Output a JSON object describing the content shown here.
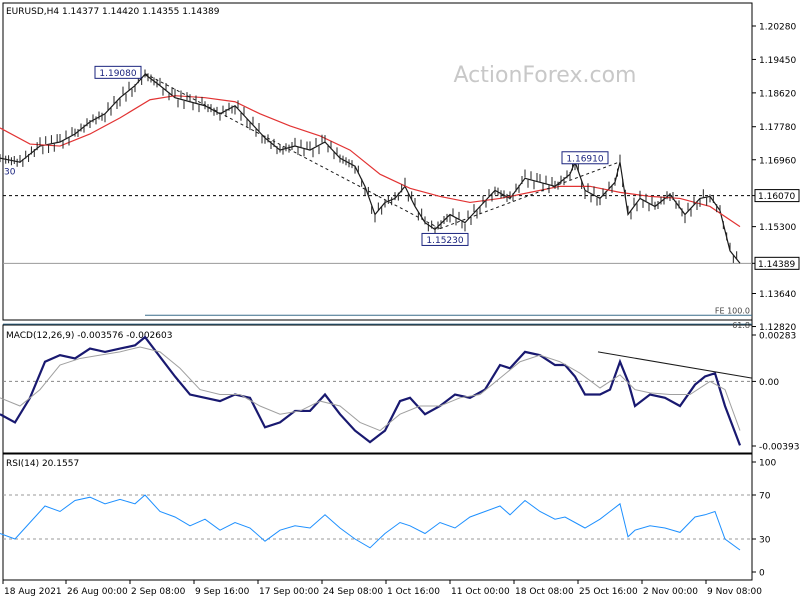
{
  "chart_data": [
    {
      "type": "line",
      "panel": "price",
      "title": "EURUSD,H4  1.14377 1.14420 1.14355 1.14389",
      "watermark": "ActionForex.com",
      "y_ticks": [
        "1.20280",
        "1.19450",
        "1.18620",
        "1.17780",
        "1.16960",
        "1.16070",
        "1.15300",
        "1.14389",
        "1.13640",
        "1.12820"
      ],
      "ylim": [
        1.1282,
        1.2068
      ],
      "x_ticks": [
        "18 Aug 2021",
        "26 Aug 00:00",
        "2 Sep 08:00",
        "9 Sep 16:00",
        "17 Sep 00:00",
        "24 Sep 08:00",
        "1 Oct 16:00",
        "11 Oct 00:00",
        "18 Oct 08:00",
        "25 Oct 16:00",
        "2 Nov 00:00",
        "9 Nov 08:00"
      ],
      "series": [
        {
          "name": "EURUSD",
          "color": "#1a1a1a",
          "points": [
            [
              0,
              1.17
            ],
            [
              20,
              1.169
            ],
            [
              40,
              1.173
            ],
            [
              60,
              1.174
            ],
            [
              75,
              1.176
            ],
            [
              90,
              1.179
            ],
            [
              105,
              1.181
            ],
            [
              120,
              1.185
            ],
            [
              135,
              1.188
            ],
            [
              145,
              1.1908
            ],
            [
              160,
              1.188
            ],
            [
              175,
              1.185
            ],
            [
              190,
              1.184
            ],
            [
              205,
              1.183
            ],
            [
              220,
              1.181
            ],
            [
              235,
              1.183
            ],
            [
              250,
              1.179
            ],
            [
              265,
              1.175
            ],
            [
              280,
              1.172
            ],
            [
              295,
              1.173
            ],
            [
              310,
              1.172
            ],
            [
              325,
              1.174
            ],
            [
              340,
              1.17
            ],
            [
              355,
              1.168
            ],
            [
              365,
              1.163
            ],
            [
              375,
              1.156
            ],
            [
              385,
              1.159
            ],
            [
              395,
              1.16
            ],
            [
              405,
              1.163
            ],
            [
              415,
              1.158
            ],
            [
              425,
              1.154
            ],
            [
              435,
              1.1523
            ],
            [
              450,
              1.156
            ],
            [
              465,
              1.154
            ],
            [
              480,
              1.158
            ],
            [
              495,
              1.162
            ],
            [
              510,
              1.16
            ],
            [
              525,
              1.165
            ],
            [
              540,
              1.164
            ],
            [
              555,
              1.163
            ],
            [
              570,
              1.166
            ],
            [
              575,
              1.1691
            ],
            [
              585,
              1.162
            ],
            [
              600,
              1.16
            ],
            [
              615,
              1.164
            ],
            [
              620,
              1.169
            ],
            [
              628,
              1.156
            ],
            [
              640,
              1.16
            ],
            [
              655,
              1.158
            ],
            [
              670,
              1.161
            ],
            [
              685,
              1.156
            ],
            [
              700,
              1.16
            ],
            [
              710,
              1.1605
            ],
            [
              720,
              1.157
            ],
            [
              730,
              1.147
            ],
            [
              740,
              1.1439
            ]
          ]
        },
        {
          "name": "MA",
          "color": "#e23333",
          "points": [
            [
              0,
              1.1775
            ],
            [
              30,
              1.1735
            ],
            [
              60,
              1.173
            ],
            [
              90,
              1.176
            ],
            [
              120,
              1.18
            ],
            [
              150,
              1.1845
            ],
            [
              175,
              1.1855
            ],
            [
              205,
              1.185
            ],
            [
              235,
              1.184
            ],
            [
              260,
              1.181
            ],
            [
              290,
              1.178
            ],
            [
              320,
              1.1755
            ],
            [
              350,
              1.172
            ],
            [
              380,
              1.166
            ],
            [
              410,
              1.1625
            ],
            [
              440,
              1.1605
            ],
            [
              470,
              1.159
            ],
            [
              500,
              1.16
            ],
            [
              530,
              1.1615
            ],
            [
              560,
              1.163
            ],
            [
              590,
              1.163
            ],
            [
              620,
              1.1615
            ],
            [
              650,
              1.1605
            ],
            [
              680,
              1.16
            ],
            [
              710,
              1.158
            ],
            [
              740,
              1.153
            ]
          ]
        },
        {
          "name": "trend-1",
          "color": "#1a1a1a",
          "dashed": true,
          "points": [
            [
              145,
              1.191
            ],
            [
              440,
              1.1525
            ]
          ]
        },
        {
          "name": "trend-2",
          "color": "#1a1a1a",
          "dashed": true,
          "points": [
            [
              440,
              1.1525
            ],
            [
              620,
              1.1691
            ]
          ]
        }
      ],
      "hlines": [
        {
          "value": 1.1607,
          "dashed": true
        },
        {
          "value": 1.14389,
          "dashed": false
        }
      ],
      "annotations": [
        {
          "text": "1.19080",
          "x": 145,
          "y": 1.1908
        },
        {
          "text": "1.15230",
          "x": 440,
          "y": 1.1523
        },
        {
          "text": "1.16910",
          "x": 610,
          "y": 1.1691
        },
        {
          "text": "30",
          "x": 0,
          "y": 1.1667
        }
      ],
      "price_labels": [
        {
          "text": "1.16070",
          "value": 1.1607
        },
        {
          "text": "1.14389",
          "value": 1.14389
        }
      ],
      "fe_labels": [
        "FE 100.0",
        "61.8"
      ],
      "fe_values": [
        1.131,
        1.1288
      ]
    },
    {
      "type": "line",
      "panel": "macd",
      "title": "MACD(12,26,9) -0.003576 -0.002603",
      "y_ticks": [
        "0.00283",
        "0.00",
        "-0.003939"
      ],
      "ylim": [
        -0.0045,
        0.0033
      ],
      "series": [
        {
          "name": "MACD",
          "color": "#191970",
          "points": [
            [
              0,
              -0.002
            ],
            [
              15,
              -0.0025
            ],
            [
              30,
              -0.001
            ],
            [
              45,
              0.0012
            ],
            [
              60,
              0.0016
            ],
            [
              75,
              0.0014
            ],
            [
              90,
              0.002
            ],
            [
              105,
              0.0018
            ],
            [
              120,
              0.002
            ],
            [
              135,
              0.0022
            ],
            [
              145,
              0.0027
            ],
            [
              160,
              0.0015
            ],
            [
              175,
              0.0003
            ],
            [
              190,
              -0.0008
            ],
            [
              205,
              -0.001
            ],
            [
              220,
              -0.0012
            ],
            [
              235,
              -0.0008
            ],
            [
              250,
              -0.001
            ],
            [
              265,
              -0.0028
            ],
            [
              280,
              -0.0025
            ],
            [
              295,
              -0.0018
            ],
            [
              310,
              -0.0018
            ],
            [
              325,
              -0.0008
            ],
            [
              340,
              -0.002
            ],
            [
              355,
              -0.003
            ],
            [
              370,
              -0.0037
            ],
            [
              385,
              -0.003
            ],
            [
              400,
              -0.0012
            ],
            [
              410,
              -0.001
            ],
            [
              425,
              -0.002
            ],
            [
              440,
              -0.0015
            ],
            [
              455,
              -0.0008
            ],
            [
              470,
              -0.001
            ],
            [
              485,
              -0.0005
            ],
            [
              500,
              0.001
            ],
            [
              510,
              0.0008
            ],
            [
              525,
              0.0018
            ],
            [
              540,
              0.0016
            ],
            [
              555,
              0.001
            ],
            [
              565,
              0.001
            ],
            [
              575,
              0.0003
            ],
            [
              585,
              -0.0008
            ],
            [
              600,
              -0.0008
            ],
            [
              610,
              -0.0005
            ],
            [
              620,
              0.0012
            ],
            [
              628,
              0.0
            ],
            [
              635,
              -0.0015
            ],
            [
              650,
              -0.0008
            ],
            [
              665,
              -0.001
            ],
            [
              680,
              -0.0015
            ],
            [
              695,
              -0.0002
            ],
            [
              705,
              0.0003
            ],
            [
              715,
              0.0005
            ],
            [
              725,
              -0.0015
            ],
            [
              740,
              -0.0039
            ]
          ]
        },
        {
          "name": "Signal",
          "color": "#a0a0a0",
          "points": [
            [
              0,
              -0.001
            ],
            [
              20,
              -0.0015
            ],
            [
              40,
              -0.0005
            ],
            [
              60,
              0.001
            ],
            [
              80,
              0.0014
            ],
            [
              100,
              0.0016
            ],
            [
              120,
              0.0018
            ],
            [
              140,
              0.0021
            ],
            [
              160,
              0.0018
            ],
            [
              180,
              0.0008
            ],
            [
              200,
              -0.0005
            ],
            [
              220,
              -0.0008
            ],
            [
              240,
              -0.0008
            ],
            [
              260,
              -0.0015
            ],
            [
              280,
              -0.002
            ],
            [
              300,
              -0.0018
            ],
            [
              320,
              -0.0012
            ],
            [
              340,
              -0.0015
            ],
            [
              360,
              -0.0025
            ],
            [
              380,
              -0.003
            ],
            [
              400,
              -0.002
            ],
            [
              420,
              -0.0015
            ],
            [
              440,
              -0.0015
            ],
            [
              460,
              -0.001
            ],
            [
              480,
              -0.0008
            ],
            [
              500,
              0.0002
            ],
            [
              520,
              0.0012
            ],
            [
              540,
              0.0016
            ],
            [
              560,
              0.0012
            ],
            [
              580,
              0.0005
            ],
            [
              600,
              -0.0004
            ],
            [
              620,
              0.0004
            ],
            [
              635,
              -0.0005
            ],
            [
              650,
              -0.0007
            ],
            [
              670,
              -0.0008
            ],
            [
              690,
              -0.0008
            ],
            [
              710,
              0.0
            ],
            [
              725,
              -0.0005
            ],
            [
              740,
              -0.003
            ]
          ]
        },
        {
          "name": "trendline",
          "color": "#1a1a1a",
          "points": [
            [
              598,
              0.0018
            ],
            [
              752,
              0.0002
            ]
          ]
        }
      ],
      "hlines": [
        {
          "value": 0,
          "dashed": true
        }
      ]
    },
    {
      "type": "line",
      "panel": "rsi",
      "title": "RSI(14) 20.1557",
      "y_ticks": [
        "100",
        "70",
        "30",
        "0"
      ],
      "ylim": [
        0,
        100
      ],
      "series": [
        {
          "name": "RSI",
          "color": "#1e90ff",
          "points": [
            [
              0,
              35
            ],
            [
              15,
              30
            ],
            [
              30,
              45
            ],
            [
              45,
              60
            ],
            [
              60,
              55
            ],
            [
              75,
              65
            ],
            [
              90,
              68
            ],
            [
              105,
              62
            ],
            [
              120,
              66
            ],
            [
              135,
              62
            ],
            [
              145,
              70
            ],
            [
              160,
              55
            ],
            [
              175,
              50
            ],
            [
              190,
              42
            ],
            [
              205,
              48
            ],
            [
              220,
              38
            ],
            [
              235,
              45
            ],
            [
              250,
              40
            ],
            [
              265,
              28
            ],
            [
              280,
              38
            ],
            [
              295,
              42
            ],
            [
              310,
              40
            ],
            [
              325,
              52
            ],
            [
              340,
              40
            ],
            [
              355,
              30
            ],
            [
              370,
              22
            ],
            [
              385,
              35
            ],
            [
              400,
              45
            ],
            [
              410,
              42
            ],
            [
              425,
              35
            ],
            [
              440,
              45
            ],
            [
              455,
              40
            ],
            [
              470,
              50
            ],
            [
              485,
              55
            ],
            [
              500,
              60
            ],
            [
              510,
              52
            ],
            [
              525,
              65
            ],
            [
              540,
              55
            ],
            [
              555,
              48
            ],
            [
              565,
              50
            ],
            [
              575,
              45
            ],
            [
              585,
              40
            ],
            [
              600,
              48
            ],
            [
              610,
              55
            ],
            [
              620,
              62
            ],
            [
              628,
              32
            ],
            [
              635,
              38
            ],
            [
              650,
              42
            ],
            [
              665,
              40
            ],
            [
              680,
              36
            ],
            [
              695,
              50
            ],
            [
              705,
              52
            ],
            [
              715,
              55
            ],
            [
              725,
              30
            ],
            [
              740,
              20
            ]
          ]
        }
      ],
      "hlines": [
        {
          "value": 70,
          "dashed": true
        },
        {
          "value": 30,
          "dashed": true
        }
      ]
    }
  ]
}
